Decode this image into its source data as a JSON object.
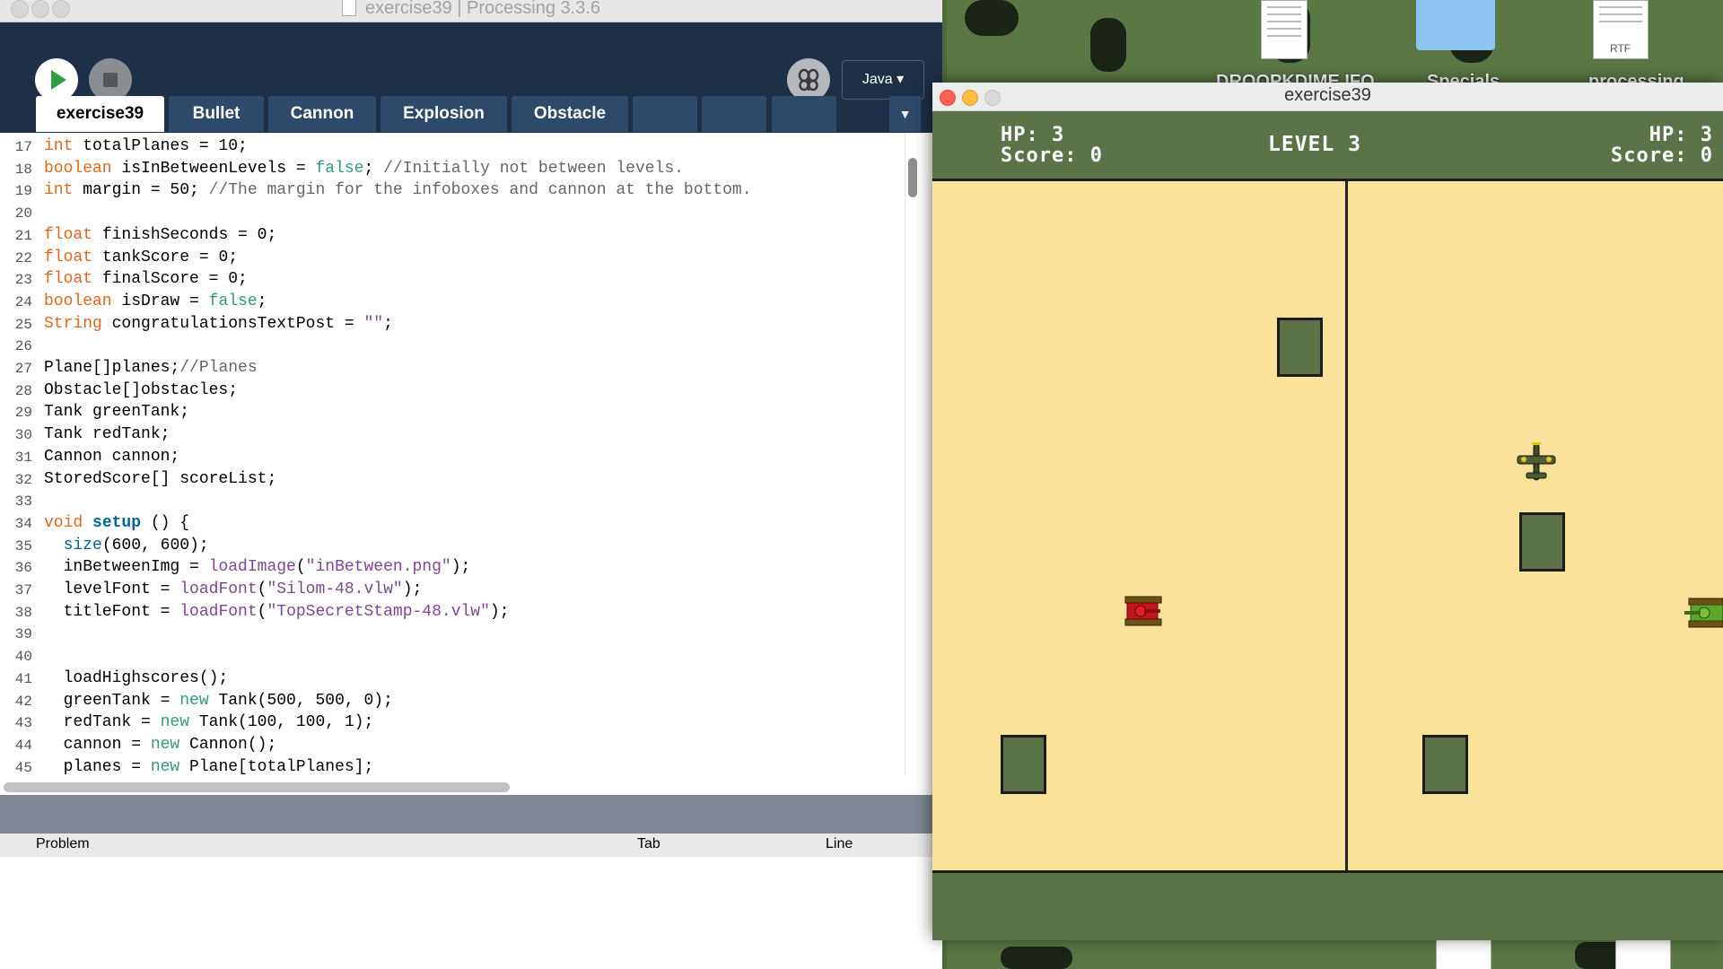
{
  "ide": {
    "window_title": "exercise39 | Processing 3.3.6",
    "mode": "Java",
    "tabs": [
      "exercise39",
      "Bullet",
      "Cannon",
      "Explosion",
      "Obstacle"
    ],
    "active_tab": "exercise39",
    "problems": {
      "col_problem": "Problem",
      "col_tab": "Tab",
      "col_line": "Line"
    },
    "code_lines": [
      {
        "n": "17",
        "html": "<span class='kw'>int</span> totalPlanes = 10;"
      },
      {
        "n": "18",
        "html": "<span class='kw'>boolean</span> isInBetweenLevels = <span class='bi'>false</span>; <span class='cm'>//Initially not between levels.</span>"
      },
      {
        "n": "19",
        "html": "<span class='kw'>int</span> margin = 50; <span class='cm'>//The margin for the infoboxes and cannon at the bottom.</span>"
      },
      {
        "n": "20",
        "html": ""
      },
      {
        "n": "21",
        "html": "<span class='kw'>float</span> finishSeconds = 0;"
      },
      {
        "n": "22",
        "html": "<span class='kw'>float</span> tankScore = 0;"
      },
      {
        "n": "23",
        "html": "<span class='kw'>float</span> finalScore = 0;"
      },
      {
        "n": "24",
        "html": "<span class='kw'>boolean</span> isDraw = <span class='bi'>false</span>;"
      },
      {
        "n": "25",
        "html": "<span class='kw'>String</span> congratulationsTextPost = <span class='st'>\"\"</span>;"
      },
      {
        "n": "26",
        "html": ""
      },
      {
        "n": "27",
        "html": "Plane[]planes;<span class='cm'>//Planes</span>"
      },
      {
        "n": "28",
        "html": "Obstacle[]obstacles;"
      },
      {
        "n": "29",
        "html": "Tank greenTank;"
      },
      {
        "n": "30",
        "html": "Tank redTank;"
      },
      {
        "n": "31",
        "html": "Cannon cannon;"
      },
      {
        "n": "32",
        "html": "StoredScore[] scoreList;"
      },
      {
        "n": "33",
        "html": ""
      },
      {
        "n": "34",
        "html": "<span class='kw'>void</span> <span class='fn'>setup</span> () {"
      },
      {
        "n": "35",
        "html": "  <span class='sz'>size</span>(600, 600);"
      },
      {
        "n": "36",
        "html": "  inBetweenImg = <span class='lf'>loadImage</span>(<span class='st'>\"inBetween.png\"</span>);"
      },
      {
        "n": "37",
        "html": "  levelFont = <span class='lf'>loadFont</span>(<span class='st'>\"Silom-48.vlw\"</span>);"
      },
      {
        "n": "38",
        "html": "  titleFont = <span class='lf'>loadFont</span>(<span class='st'>\"TopSecretStamp-48.vlw\"</span>);"
      },
      {
        "n": "39",
        "html": ""
      },
      {
        "n": "40",
        "html": ""
      },
      {
        "n": "41",
        "html": "  loadHighscores();"
      },
      {
        "n": "42",
        "html": "  greenTank = <span class='ne'>new</span> Tank(500, 500, 0);"
      },
      {
        "n": "43",
        "html": "  redTank = <span class='ne'>new</span> Tank(100, 100, 1);"
      },
      {
        "n": "44",
        "html": "  cannon = <span class='ne'>new</span> Cannon();"
      },
      {
        "n": "45",
        "html": "  planes = <span class='ne'>new</span> Plane[totalPlanes];"
      }
    ]
  },
  "sketch": {
    "window_title": "exercise39",
    "left_hp": "HP: 3",
    "left_score": "Score: 0",
    "level": "LEVEL 3",
    "right_hp": "HP: 3",
    "right_score": "Score: 0"
  },
  "desktop": {
    "icon_labels": [
      "DROOPKDIME IFO",
      "Specials",
      "processing"
    ],
    "rtf_label": "RTF"
  },
  "colors": {
    "toolbar": "#1e3047",
    "tab": "#2d4a6a",
    "field": "#fbe29a",
    "hud": "#5c7347"
  }
}
